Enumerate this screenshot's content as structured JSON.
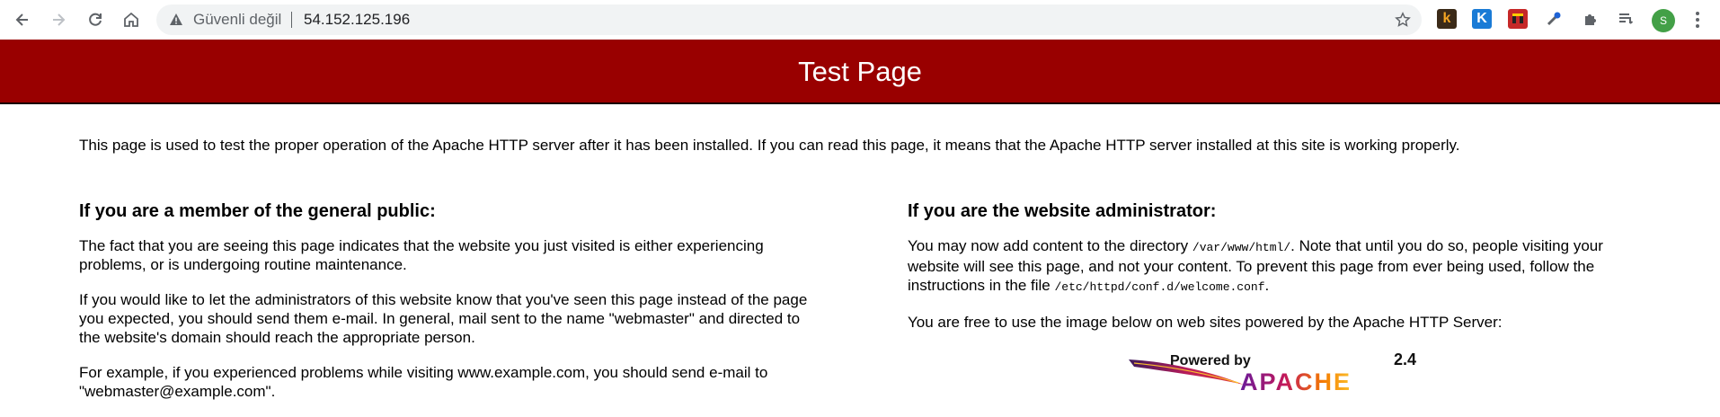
{
  "browser": {
    "security_label": "Güvenli değil",
    "url": "54.152.125.196",
    "avatar_letter": "S",
    "extensions": [
      "k",
      "K",
      "",
      "",
      "",
      ""
    ]
  },
  "page": {
    "title": "Test Page",
    "intro": "This page is used to test the proper operation of the Apache HTTP server after it has been installed. If you can read this page, it means that the Apache HTTP server installed at this site is working properly.",
    "public": {
      "heading": "If you are a member of the general public:",
      "p1": "The fact that you are seeing this page indicates that the website you just visited is either experiencing problems, or is undergoing routine maintenance.",
      "p2": "If you would like to let the administrators of this website know that you've seen this page instead of the page you expected, you should send them e-mail. In general, mail sent to the name \"webmaster\" and directed to the website's domain should reach the appropriate person.",
      "p3": "For example, if you experienced problems while visiting www.example.com, you should send e-mail to \"webmaster@example.com\"."
    },
    "admin": {
      "heading": "If you are the website administrator:",
      "p1_a": "You may now add content to the directory ",
      "p1_code1": "/var/www/html/",
      "p1_b": ". Note that until you do so, people visiting your website will see this page, and not your content. To prevent this page from ever being used, follow the instructions in the file ",
      "p1_code2": "/etc/httpd/conf.d/welcome.conf",
      "p1_c": ".",
      "p2": "You are free to use the image below on web sites powered by the Apache HTTP Server:"
    },
    "logo": {
      "powered_by": "Powered by",
      "version": "2.4",
      "name": "APACHE"
    }
  },
  "colors": {
    "banner": "#990000",
    "omnibox": "#f1f3f4"
  }
}
